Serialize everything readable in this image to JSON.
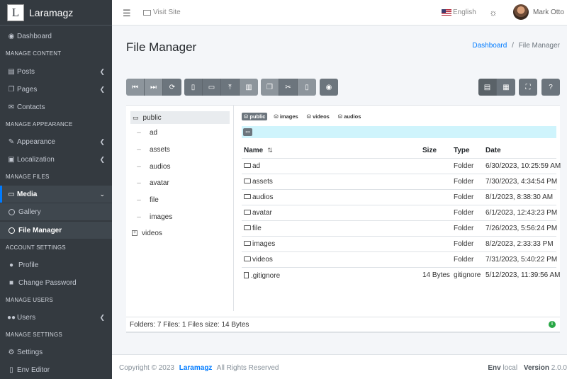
{
  "brand": {
    "logo_letter": "L",
    "name": "Laramagz"
  },
  "sidebar": {
    "dashboard": "Dashboard",
    "manage_content": "MANAGE CONTENT",
    "posts": "Posts",
    "pages": "Pages",
    "contacts": "Contacts",
    "manage_appearance": "MANAGE APPEARANCE",
    "appearance": "Appearance",
    "localization": "Localization",
    "manage_files": "MANAGE FILES",
    "media": "Media",
    "gallery": "Gallery",
    "file_manager": "File Manager",
    "account_settings": "ACCOUNT SETTINGS",
    "profile": "Profile",
    "change_password": "Change Password",
    "manage_users": "MANAGE USERS",
    "users": "Users",
    "manage_settings": "MANAGE SETTINGS",
    "settings": "Settings",
    "env_editor": "Env Editor"
  },
  "topbar": {
    "visit_site": "Visit Site",
    "language": "English",
    "user_name": "Mark Otto"
  },
  "page": {
    "title": "File Manager",
    "breadcrumb_home": "Dashboard",
    "breadcrumb_sep": "/",
    "breadcrumb_current": "File Manager"
  },
  "tree": {
    "root": "public",
    "items": [
      "ad",
      "assets",
      "audios",
      "avatar",
      "file",
      "images",
      "videos"
    ]
  },
  "crumbs": [
    "public",
    "images",
    "videos",
    "audios"
  ],
  "table": {
    "headers": {
      "name": "Name",
      "size": "Size",
      "type": "Type",
      "date": "Date"
    },
    "rows": [
      {
        "name": "ad",
        "size": "",
        "type": "Folder",
        "date": "6/30/2023, 10:25:59 AM"
      },
      {
        "name": "assets",
        "size": "",
        "type": "Folder",
        "date": "7/30/2023, 4:34:54 PM"
      },
      {
        "name": "audios",
        "size": "",
        "type": "Folder",
        "date": "8/1/2023, 8:38:30 AM"
      },
      {
        "name": "avatar",
        "size": "",
        "type": "Folder",
        "date": "6/1/2023, 12:43:23 PM"
      },
      {
        "name": "file",
        "size": "",
        "type": "Folder",
        "date": "7/26/2023, 5:56:24 PM"
      },
      {
        "name": "images",
        "size": "",
        "type": "Folder",
        "date": "8/2/2023, 2:33:33 PM"
      },
      {
        "name": "videos",
        "size": "",
        "type": "Folder",
        "date": "7/31/2023, 5:40:22 PM"
      },
      {
        "name": ".gitignore",
        "size": "14 Bytes",
        "type": "gitignore",
        "date": "5/12/2023, 11:39:56 AM"
      }
    ]
  },
  "status": {
    "text": "Folders: 7 Files: 1 Files size: 14 Bytes"
  },
  "footer": {
    "copyright": "Copyright © 2023",
    "brand": "Laramagz",
    "rights": "All Rights Reserved",
    "env_label": "Env",
    "env_value": "local",
    "version_label": "Version",
    "version_value": "2.0.0"
  }
}
